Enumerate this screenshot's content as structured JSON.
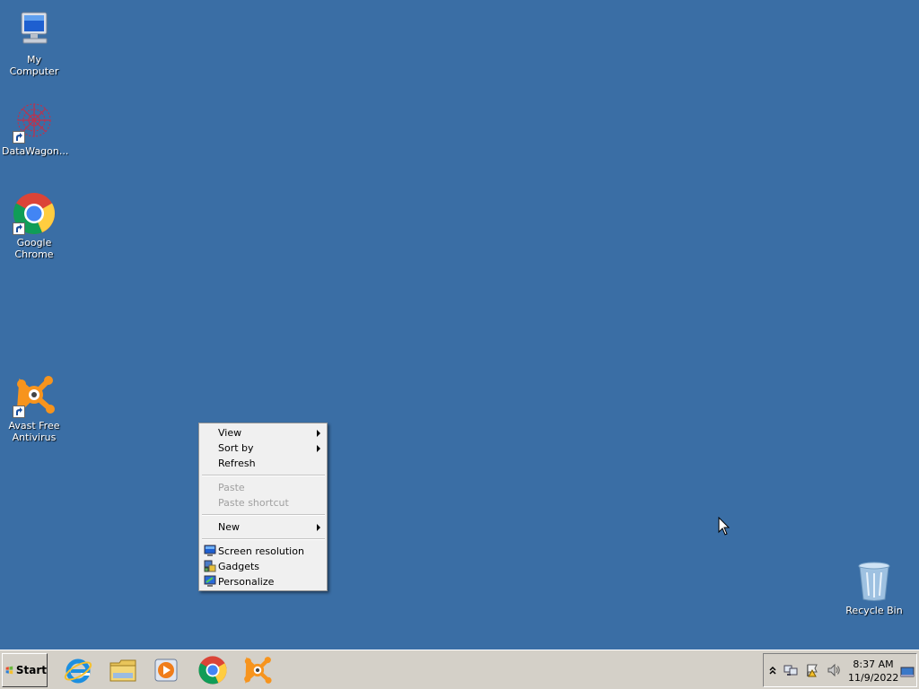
{
  "desktop": {
    "icons": [
      {
        "label": "My Computer"
      },
      {
        "label": "DataWagon..."
      },
      {
        "label": "Google Chrome"
      },
      {
        "label": "Avast Free Antivirus"
      },
      {
        "label": "Recycle Bin"
      }
    ]
  },
  "context_menu": {
    "items": [
      {
        "label": "View",
        "submenu": true
      },
      {
        "label": "Sort by",
        "submenu": true
      },
      {
        "label": "Refresh"
      },
      {
        "label": "Paste",
        "disabled": true
      },
      {
        "label": "Paste shortcut",
        "disabled": true
      },
      {
        "label": "New",
        "submenu": true
      },
      {
        "label": "Screen resolution"
      },
      {
        "label": "Gadgets"
      },
      {
        "label": "Personalize"
      }
    ]
  },
  "taskbar": {
    "start_label": "Start",
    "pinned": [
      "internet-explorer-icon",
      "file-explorer-icon",
      "media-player-icon",
      "chrome-icon",
      "avast-icon"
    ],
    "clock": {
      "time": "8:37 AM",
      "date": "11/9/2022"
    }
  },
  "colors": {
    "desktop": "#3a6ea5",
    "taskbar": "#d4d0c8"
  }
}
